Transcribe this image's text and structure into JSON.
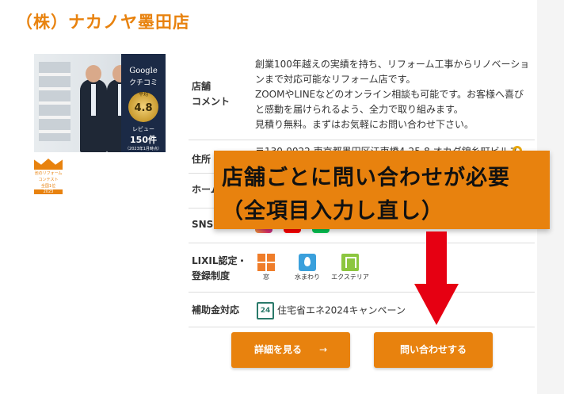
{
  "shop": {
    "title": "（株）ナカノヤ墨田店"
  },
  "badge": {
    "google": "Google",
    "kuchikomi": "クチコミ",
    "average_label": "平均",
    "rating": "4.8",
    "review_label": "レビュー",
    "review_count": "150件",
    "date_note": "（2023年1月時点）"
  },
  "contest": {
    "line1": "池のリフォーム",
    "line2": "コンテスト",
    "line3": "全国1位",
    "year": "2023"
  },
  "table": {
    "comment_label": "店舗\nコメント",
    "comment_text": "創業100年越えの実績を持ち、リフォーム工事からリノベーションまで対応可能なリフォーム店です。\nZOOMやLINEなどのオンライン相談も可能です。お客様へ喜びと感動を届けられるよう、全力で取り組みます。\n見積り無料。まずはお気軽にお問い合わせ下さい。",
    "address_label": "住所",
    "address_text": "〒130-0022 東京都墨田区江東橋4-25-8 オカダ錦糸町ビルス",
    "home_label": "ホーム",
    "sns_label": "SNS",
    "lixil_label": "LIXIL認定・\n登録制度",
    "lixil_items": [
      {
        "label": "窓",
        "icon": "window-icon"
      },
      {
        "label": "水まわり",
        "icon": "water-icon"
      },
      {
        "label": "エクステリア",
        "icon": "exterior-icon"
      }
    ],
    "subsidy_label": "補助金対応",
    "subsidy_icon_text": "24",
    "subsidy_text": "住宅省エネ2024キャンペーン"
  },
  "buttons": {
    "detail": "詳細を見る",
    "detail_arrow": "→",
    "inquiry": "問い合わせする"
  },
  "overlay": {
    "line1": "店舗ごとに問い合わせが必要",
    "line2": "（全項目入力し直し）"
  },
  "colors": {
    "accent": "#e8820e",
    "arrow": "#e60012"
  }
}
